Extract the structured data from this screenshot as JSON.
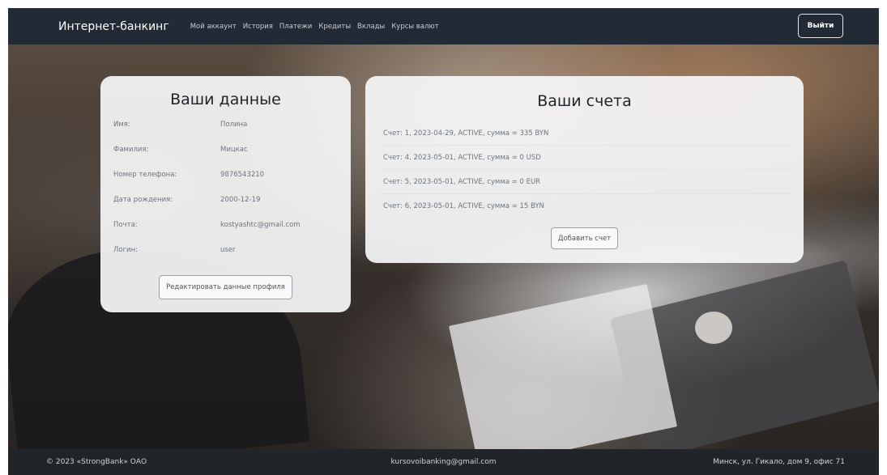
{
  "navbar": {
    "brand": "Интернет-банкинг",
    "links": [
      "Мой аккаунт",
      "История",
      "Платежи",
      "Кредиты",
      "Вклады",
      "Курсы валют"
    ],
    "logout_label": "Выйти"
  },
  "profile": {
    "title": "Ваши данные",
    "fields": [
      {
        "label": "Имя:",
        "value": "Полина"
      },
      {
        "label": "Фамилия:",
        "value": "Мицкас"
      },
      {
        "label": "Номер телефона:",
        "value": "9876543210"
      },
      {
        "label": "Дата рождения:",
        "value": "2000-12-19"
      },
      {
        "label": "Почта:",
        "value": "kostyashtc@gmail.com"
      },
      {
        "label": "Логин:",
        "value": "user"
      }
    ],
    "edit_label": "Редактировать данные профиля"
  },
  "accounts": {
    "title": "Ваши счета",
    "items": [
      "Счет: 1, 2023-04-29, ACTIVE, сумма = 335 BYN",
      "Счет: 4, 2023-05-01, ACTIVE, сумма = 0 USD",
      "Счет: 5, 2023-05-01, ACTIVE, сумма = 0 EUR",
      "Счет: 6, 2023-05-01, ACTIVE, сумма = 15 BYN"
    ],
    "add_label": "Добавить счет"
  },
  "footer": {
    "copyright": "© 2023 «StrongBank» ОАО",
    "email": "kursovoibanking@gmail.com",
    "address": "Минск, ул. Гикало, дом 9, офис 71"
  }
}
